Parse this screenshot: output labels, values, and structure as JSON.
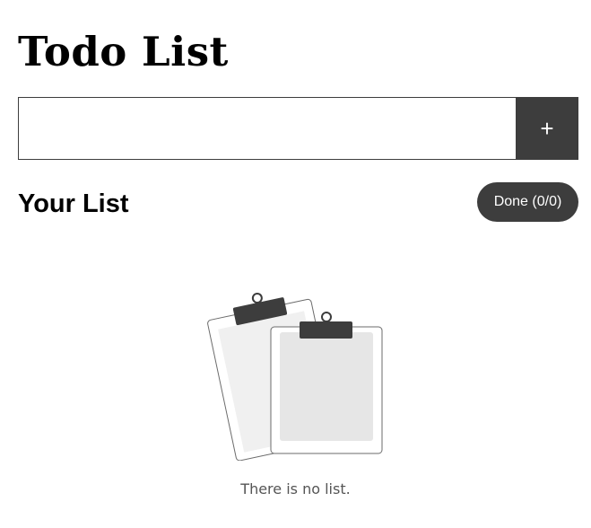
{
  "app": {
    "title": "Todo List"
  },
  "add_form": {
    "input_value": "",
    "input_placeholder": "",
    "add_button_label": "+"
  },
  "list": {
    "heading": "Your List",
    "done_button_label": "Done (0/0)",
    "empty_message": "There is no list.",
    "empty_icon": "clipboards-icon"
  },
  "colors": {
    "primary": "#3d3d3d",
    "background": "#ffffff",
    "text": "#000000",
    "muted_text": "#555555"
  }
}
